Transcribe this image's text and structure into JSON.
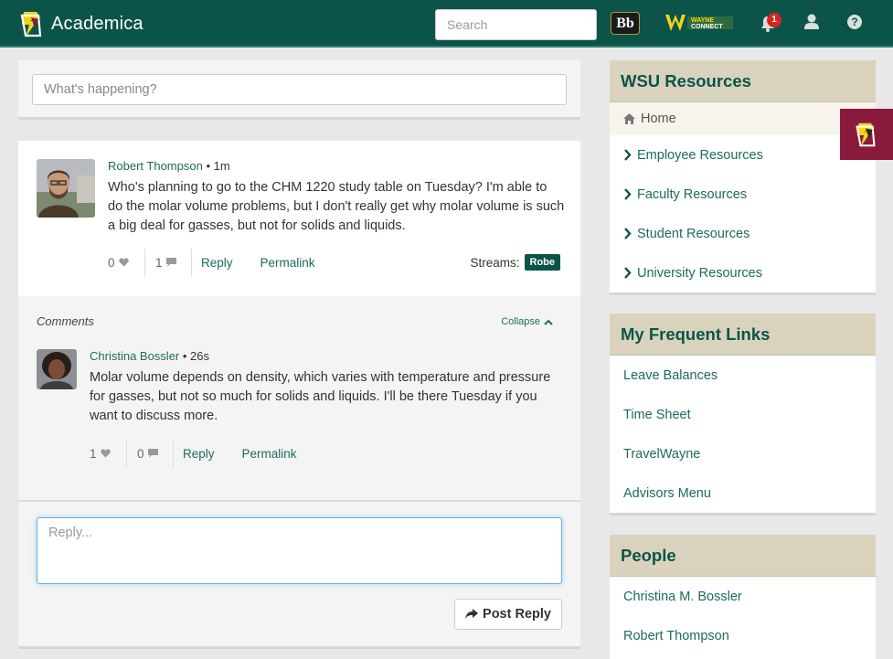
{
  "header": {
    "app_name": "Academica",
    "search_placeholder": "Search",
    "blackboard_label": "Bb",
    "notification_count": "1",
    "help_label": "?",
    "wayne_connect_line1": "WAYNE",
    "wayne_connect_line2": "CONNECT"
  },
  "status": {
    "placeholder": "What's happening?"
  },
  "post": {
    "author": "Robert Thompson",
    "time": "• 1m",
    "body": "Who's planning to go to the CHM 1220 study table on Tuesday? I'm able to do the molar volume problems, but I don't really get why molar volume is such a big deal for gasses, but not for solids and liquids.",
    "likes": "0",
    "comments": "1",
    "reply_label": "Reply",
    "permalink_label": "Permalink",
    "streams_label": "Streams:",
    "stream_badge": "Robe"
  },
  "comments_section": {
    "label": "Comments",
    "collapse_label": "Collapse"
  },
  "comment": {
    "author": "Christina Bossler",
    "time": "• 26s",
    "body": "Molar volume depends on density, which varies with temperature and pressure for gasses, but not so much for solids and liquids. I'll be there Tuesday if you want to discuss more.",
    "likes": "1",
    "comments": "0",
    "reply_label": "Reply",
    "permalink_label": "Permalink"
  },
  "reply": {
    "placeholder": "Reply...",
    "button_label": "Post Reply"
  },
  "sidebar": {
    "resources": {
      "title": "WSU Resources",
      "home_label": "Home",
      "items": [
        {
          "label": "Employee Resources"
        },
        {
          "label": "Faculty Resources"
        },
        {
          "label": "Student Resources"
        },
        {
          "label": "University Resources"
        }
      ]
    },
    "frequent": {
      "title": "My Frequent Links",
      "items": [
        {
          "label": "Leave Balances"
        },
        {
          "label": "Time Sheet"
        },
        {
          "label": "TravelWayne"
        },
        {
          "label": "Advisors Menu"
        }
      ]
    },
    "people": {
      "title": "People",
      "items": [
        {
          "label": "Christina M. Bossler"
        },
        {
          "label": "Robert Thompson"
        }
      ]
    }
  },
  "colors": {
    "header_bg": "#0c5449",
    "accent": "#1b6b5f",
    "sidebar_head_bg": "#d9d3bd",
    "badge_bg": "#8a1a3b",
    "notification_badge": "#d9231e"
  },
  "icons": {
    "brand": "academica-logo",
    "blackboard": "blackboard-icon",
    "wayne_connect": "wayne-connect-logo",
    "notifications": "bell-icon",
    "user": "user-icon",
    "help": "question-icon",
    "like": "heart-icon",
    "comment": "comment-icon",
    "collapse": "chevron-up-icon",
    "post_reply": "share-arrow-icon",
    "home": "home-icon",
    "resource_item": "chevron-right-icon",
    "floating": "academica-badge-icon"
  }
}
